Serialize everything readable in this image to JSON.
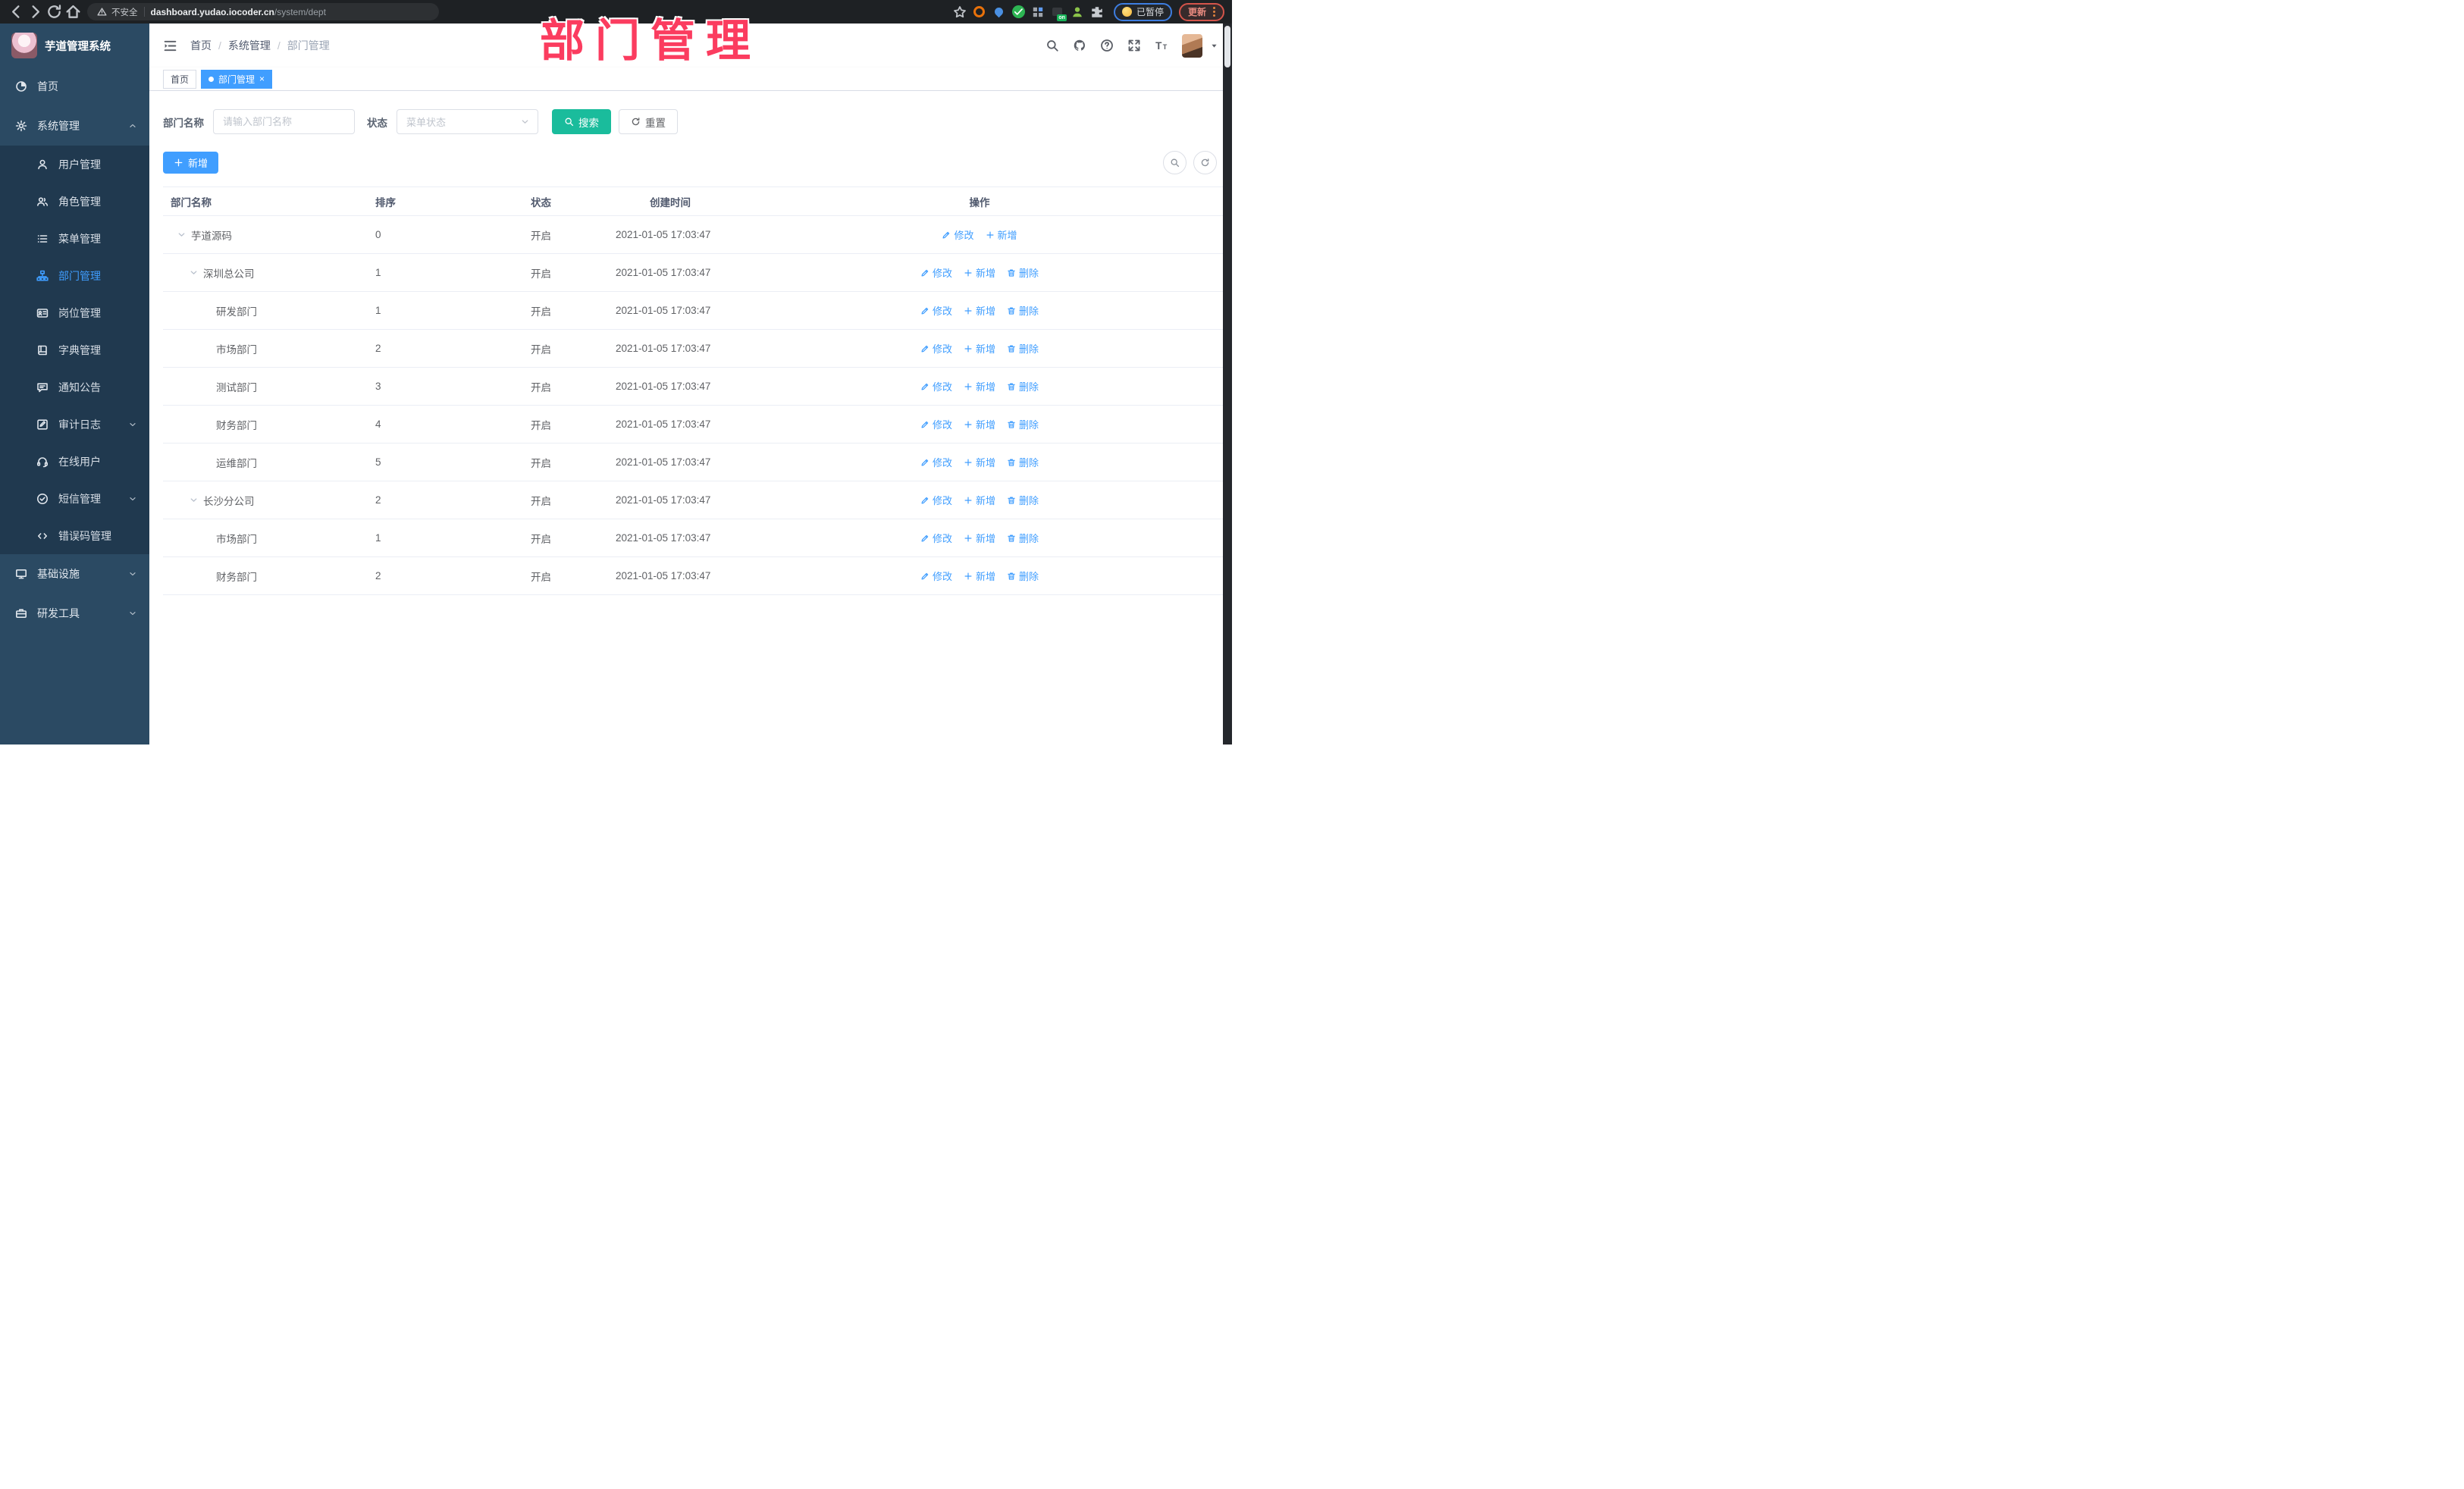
{
  "browser": {
    "security_label": "不安全",
    "url_host": "dashboard.yudao.iocoder.cn",
    "url_path": "/system/dept",
    "nav_icons": [
      "back-icon",
      "forward-icon",
      "reload-icon",
      "home-icon"
    ],
    "extension_icons": [
      "star-icon",
      "ext-orange-icon",
      "ext-pin-icon",
      "ext-check-icon",
      "ext-grid-icon",
      "ext-on-icon",
      "ext-user-icon",
      "puzzle-icon"
    ],
    "paused_badge": "已暂停",
    "update_button": "更新"
  },
  "watermark": "部门管理",
  "sidebar": {
    "app_title": "芋道管理系统",
    "items": [
      {
        "key": "home",
        "label": "首页",
        "icon": "dashboard-icon",
        "level": 0
      },
      {
        "key": "system",
        "label": "系统管理",
        "icon": "gear-icon",
        "level": 0,
        "chevron": "up",
        "expanded": true
      },
      {
        "key": "user",
        "label": "用户管理",
        "icon": "user-icon",
        "level": 1
      },
      {
        "key": "role",
        "label": "角色管理",
        "icon": "users-icon",
        "level": 1
      },
      {
        "key": "menu",
        "label": "菜单管理",
        "icon": "menu-list-icon",
        "level": 1
      },
      {
        "key": "dept",
        "label": "部门管理",
        "icon": "org-tree-icon",
        "level": 1,
        "active": true
      },
      {
        "key": "post",
        "label": "岗位管理",
        "icon": "id-card-icon",
        "level": 1
      },
      {
        "key": "dict",
        "label": "字典管理",
        "icon": "book-icon",
        "level": 1
      },
      {
        "key": "notice",
        "label": "通知公告",
        "icon": "announcement-icon",
        "level": 1
      },
      {
        "key": "audit",
        "label": "审计日志",
        "icon": "audit-log-icon",
        "level": 1,
        "chevron": "down"
      },
      {
        "key": "online",
        "label": "在线用户",
        "icon": "online-user-icon",
        "level": 1
      },
      {
        "key": "sms",
        "label": "短信管理",
        "icon": "sms-icon",
        "level": 1,
        "chevron": "down"
      },
      {
        "key": "errcode",
        "label": "错误码管理",
        "icon": "code-icon",
        "level": 1
      },
      {
        "key": "infra",
        "label": "基础设施",
        "icon": "infra-icon",
        "level": 0,
        "chevron": "down"
      },
      {
        "key": "devtools",
        "label": "研发工具",
        "icon": "tools-icon",
        "level": 0,
        "chevron": "down"
      }
    ]
  },
  "header": {
    "breadcrumb": [
      "首页",
      "系统管理",
      "部门管理"
    ],
    "action_icons": [
      "search-icon",
      "github-icon",
      "help-icon",
      "fullscreen-icon",
      "font-size-icon"
    ]
  },
  "tabs": [
    {
      "key": "home",
      "label": "首页",
      "active": false,
      "closable": false
    },
    {
      "key": "dept",
      "label": "部门管理",
      "active": true,
      "closable": true
    }
  ],
  "filters": {
    "dept_label": "部门名称",
    "dept_placeholder": "请输入部门名称",
    "dept_value": "",
    "status_label": "状态",
    "status_placeholder": "菜单状态",
    "search_label": "搜索",
    "reset_label": "重置"
  },
  "toolbar": {
    "add_label": "新增"
  },
  "table": {
    "columns": [
      "部门名称",
      "排序",
      "状态",
      "创建时间",
      "操作"
    ],
    "rows": [
      {
        "name": "芋道源码",
        "level": 0,
        "expanded": true,
        "sort": "0",
        "status": "开启",
        "created": "2021-01-05 17:03:47",
        "actions": [
          {
            "label": "修改",
            "icon": "edit-icon"
          },
          {
            "label": "新增",
            "icon": "plus-icon"
          }
        ]
      },
      {
        "name": "深圳总公司",
        "level": 1,
        "expanded": true,
        "sort": "1",
        "status": "开启",
        "created": "2021-01-05 17:03:47",
        "actions": [
          {
            "label": "修改",
            "icon": "edit-icon"
          },
          {
            "label": "新增",
            "icon": "plus-icon"
          },
          {
            "label": "删除",
            "icon": "delete-icon"
          }
        ]
      },
      {
        "name": "研发部门",
        "level": 2,
        "expanded": false,
        "sort": "1",
        "status": "开启",
        "created": "2021-01-05 17:03:47",
        "actions": [
          {
            "label": "修改",
            "icon": "edit-icon"
          },
          {
            "label": "新增",
            "icon": "plus-icon"
          },
          {
            "label": "删除",
            "icon": "delete-icon"
          }
        ]
      },
      {
        "name": "市场部门",
        "level": 2,
        "expanded": false,
        "sort": "2",
        "status": "开启",
        "created": "2021-01-05 17:03:47",
        "actions": [
          {
            "label": "修改",
            "icon": "edit-icon"
          },
          {
            "label": "新增",
            "icon": "plus-icon"
          },
          {
            "label": "删除",
            "icon": "delete-icon"
          }
        ]
      },
      {
        "name": "测试部门",
        "level": 2,
        "expanded": false,
        "sort": "3",
        "status": "开启",
        "created": "2021-01-05 17:03:47",
        "actions": [
          {
            "label": "修改",
            "icon": "edit-icon"
          },
          {
            "label": "新增",
            "icon": "plus-icon"
          },
          {
            "label": "删除",
            "icon": "delete-icon"
          }
        ]
      },
      {
        "name": "财务部门",
        "level": 2,
        "expanded": false,
        "sort": "4",
        "status": "开启",
        "created": "2021-01-05 17:03:47",
        "actions": [
          {
            "label": "修改",
            "icon": "edit-icon"
          },
          {
            "label": "新增",
            "icon": "plus-icon"
          },
          {
            "label": "删除",
            "icon": "delete-icon"
          }
        ]
      },
      {
        "name": "运维部门",
        "level": 2,
        "expanded": false,
        "sort": "5",
        "status": "开启",
        "created": "2021-01-05 17:03:47",
        "actions": [
          {
            "label": "修改",
            "icon": "edit-icon"
          },
          {
            "label": "新增",
            "icon": "plus-icon"
          },
          {
            "label": "删除",
            "icon": "delete-icon"
          }
        ]
      },
      {
        "name": "长沙分公司",
        "level": 1,
        "expanded": true,
        "sort": "2",
        "status": "开启",
        "created": "2021-01-05 17:03:47",
        "actions": [
          {
            "label": "修改",
            "icon": "edit-icon"
          },
          {
            "label": "新增",
            "icon": "plus-icon"
          },
          {
            "label": "删除",
            "icon": "delete-icon"
          }
        ]
      },
      {
        "name": "市场部门",
        "level": 2,
        "expanded": false,
        "sort": "1",
        "status": "开启",
        "created": "2021-01-05 17:03:47",
        "actions": [
          {
            "label": "修改",
            "icon": "edit-icon"
          },
          {
            "label": "新增",
            "icon": "plus-icon"
          },
          {
            "label": "删除",
            "icon": "delete-icon"
          }
        ]
      },
      {
        "name": "财务部门",
        "level": 2,
        "expanded": false,
        "sort": "2",
        "status": "开启",
        "created": "2021-01-05 17:03:47",
        "actions": [
          {
            "label": "修改",
            "icon": "edit-icon"
          },
          {
            "label": "新增",
            "icon": "plus-icon"
          },
          {
            "label": "删除",
            "icon": "delete-icon"
          }
        ]
      }
    ]
  },
  "colors": {
    "accent": "#409eff",
    "search_button": "#1abc9c",
    "watermark_pink": "#fb3c5f",
    "sidebar_bg": "#2b4a63",
    "submenu_bg": "#20394f",
    "link": "#409eff"
  }
}
